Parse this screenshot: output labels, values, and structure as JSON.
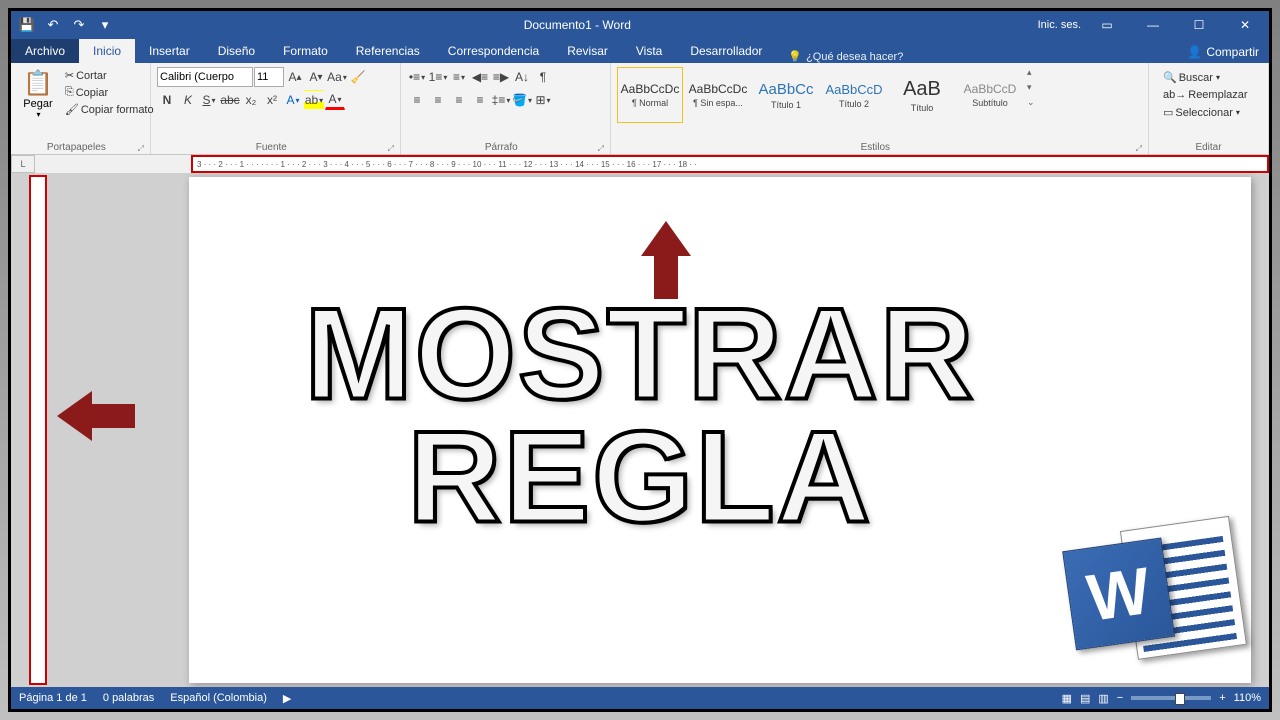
{
  "titlebar": {
    "doc_title": "Documento1 - Word",
    "signin": "Inic. ses."
  },
  "tabs": {
    "file": "Archivo",
    "items": [
      "Inicio",
      "Insertar",
      "Diseño",
      "Formato",
      "Referencias",
      "Correspondencia",
      "Revisar",
      "Vista",
      "Desarrollador"
    ],
    "tellme": "¿Qué desea hacer?",
    "share": "Compartir"
  },
  "ribbon": {
    "clipboard": {
      "label": "Portapapeles",
      "paste": "Pegar",
      "cut": "Cortar",
      "copy": "Copiar",
      "fmt": "Copiar formato"
    },
    "font": {
      "label": "Fuente",
      "name": "Calibri (Cuerpo",
      "size": "11"
    },
    "paragraph": {
      "label": "Párrafo"
    },
    "styles": {
      "label": "Estilos",
      "items": [
        {
          "preview": "AaBbCcDc",
          "name": "¶ Normal"
        },
        {
          "preview": "AaBbCcDc",
          "name": "¶ Sin espa..."
        },
        {
          "preview": "AaBbCc",
          "name": "Título 1",
          "color": "#2e74b5",
          "size": "15px"
        },
        {
          "preview": "AaBbCcD",
          "name": "Título 2",
          "color": "#2e74b5",
          "size": "13px"
        },
        {
          "preview": "AaB",
          "name": "Título",
          "color": "#333",
          "size": "20px"
        },
        {
          "preview": "AaBbCcD",
          "name": "Subtítulo",
          "color": "#888",
          "size": "12px"
        }
      ]
    },
    "editing": {
      "label": "Editar",
      "find": "Buscar",
      "replace": "Reemplazar",
      "select": "Seleccionar"
    }
  },
  "ruler_h": "3 · · · 2 · · · 1 · · · · · · · 1 · · · 2 · · · 3 · · · 4 · · · 5 · · · 6 · · · 7 · · · 8 · · · 9 · · · 10 · · · 11 · · · 12 · · · 13 · · · 14 · · · 15 · · · 16 · · · 17 · · · 18 · ·",
  "overlay": {
    "line1": "MOSTRAR",
    "line2": "REGLA"
  },
  "status": {
    "page": "Página 1 de 1",
    "words": "0 palabras",
    "lang": "Español (Colombia)",
    "zoom": "110%",
    "plus": "+",
    "minus": "−"
  },
  "word_logo": "W"
}
